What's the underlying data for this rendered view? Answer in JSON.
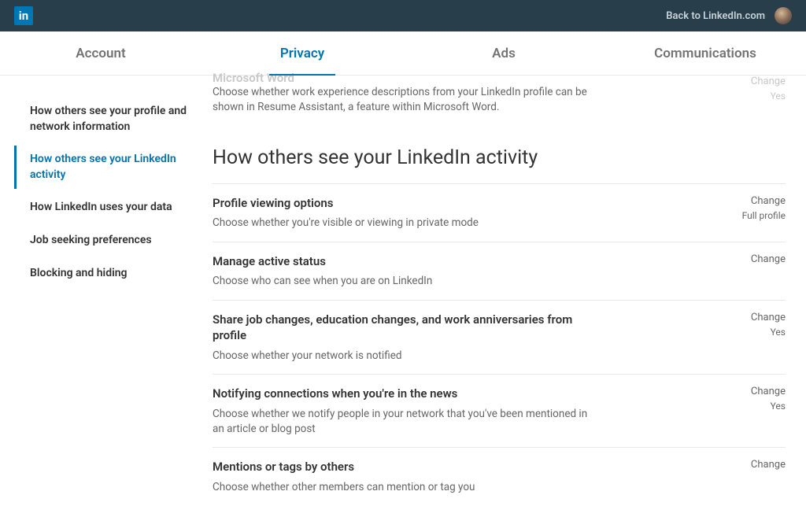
{
  "header": {
    "logo_text": "in",
    "back_link": "Back to LinkedIn.com"
  },
  "tabs": [
    {
      "label": "Account"
    },
    {
      "label": "Privacy"
    },
    {
      "label": "Ads"
    },
    {
      "label": "Communications"
    }
  ],
  "sidebar": {
    "items": [
      {
        "label": "How others see your profile and network information"
      },
      {
        "label": "How others see your LinkedIn activity"
      },
      {
        "label": "How LinkedIn uses your data"
      },
      {
        "label": "Job seeking preferences"
      },
      {
        "label": "Blocking and hiding"
      }
    ]
  },
  "partial": {
    "title": "Microsoft Word",
    "desc": "Choose whether work experience descriptions from your LinkedIn profile can be shown in Resume Assistant, a feature within Microsoft Word.",
    "change": "Change",
    "status": "Yes"
  },
  "section_heading": "How others see your LinkedIn activity",
  "settings": [
    {
      "title": "Profile viewing options",
      "desc": "Choose whether you're visible or viewing in private mode",
      "change": "Change",
      "status": "Full profile"
    },
    {
      "title": "Manage active status",
      "desc": "Choose who can see when you are on LinkedIn",
      "change": "Change",
      "status": ""
    },
    {
      "title": "Share job changes, education changes, and work anniversaries from profile",
      "desc": "Choose whether your network is notified",
      "change": "Change",
      "status": "Yes"
    },
    {
      "title": "Notifying connections when you're in the news",
      "desc": "Choose whether we notify people in your network that you've been mentioned in an article or blog post",
      "change": "Change",
      "status": "Yes"
    },
    {
      "title": "Mentions or tags by others",
      "desc": "Choose whether other members can mention or tag you",
      "change": "Change",
      "status": ""
    }
  ]
}
